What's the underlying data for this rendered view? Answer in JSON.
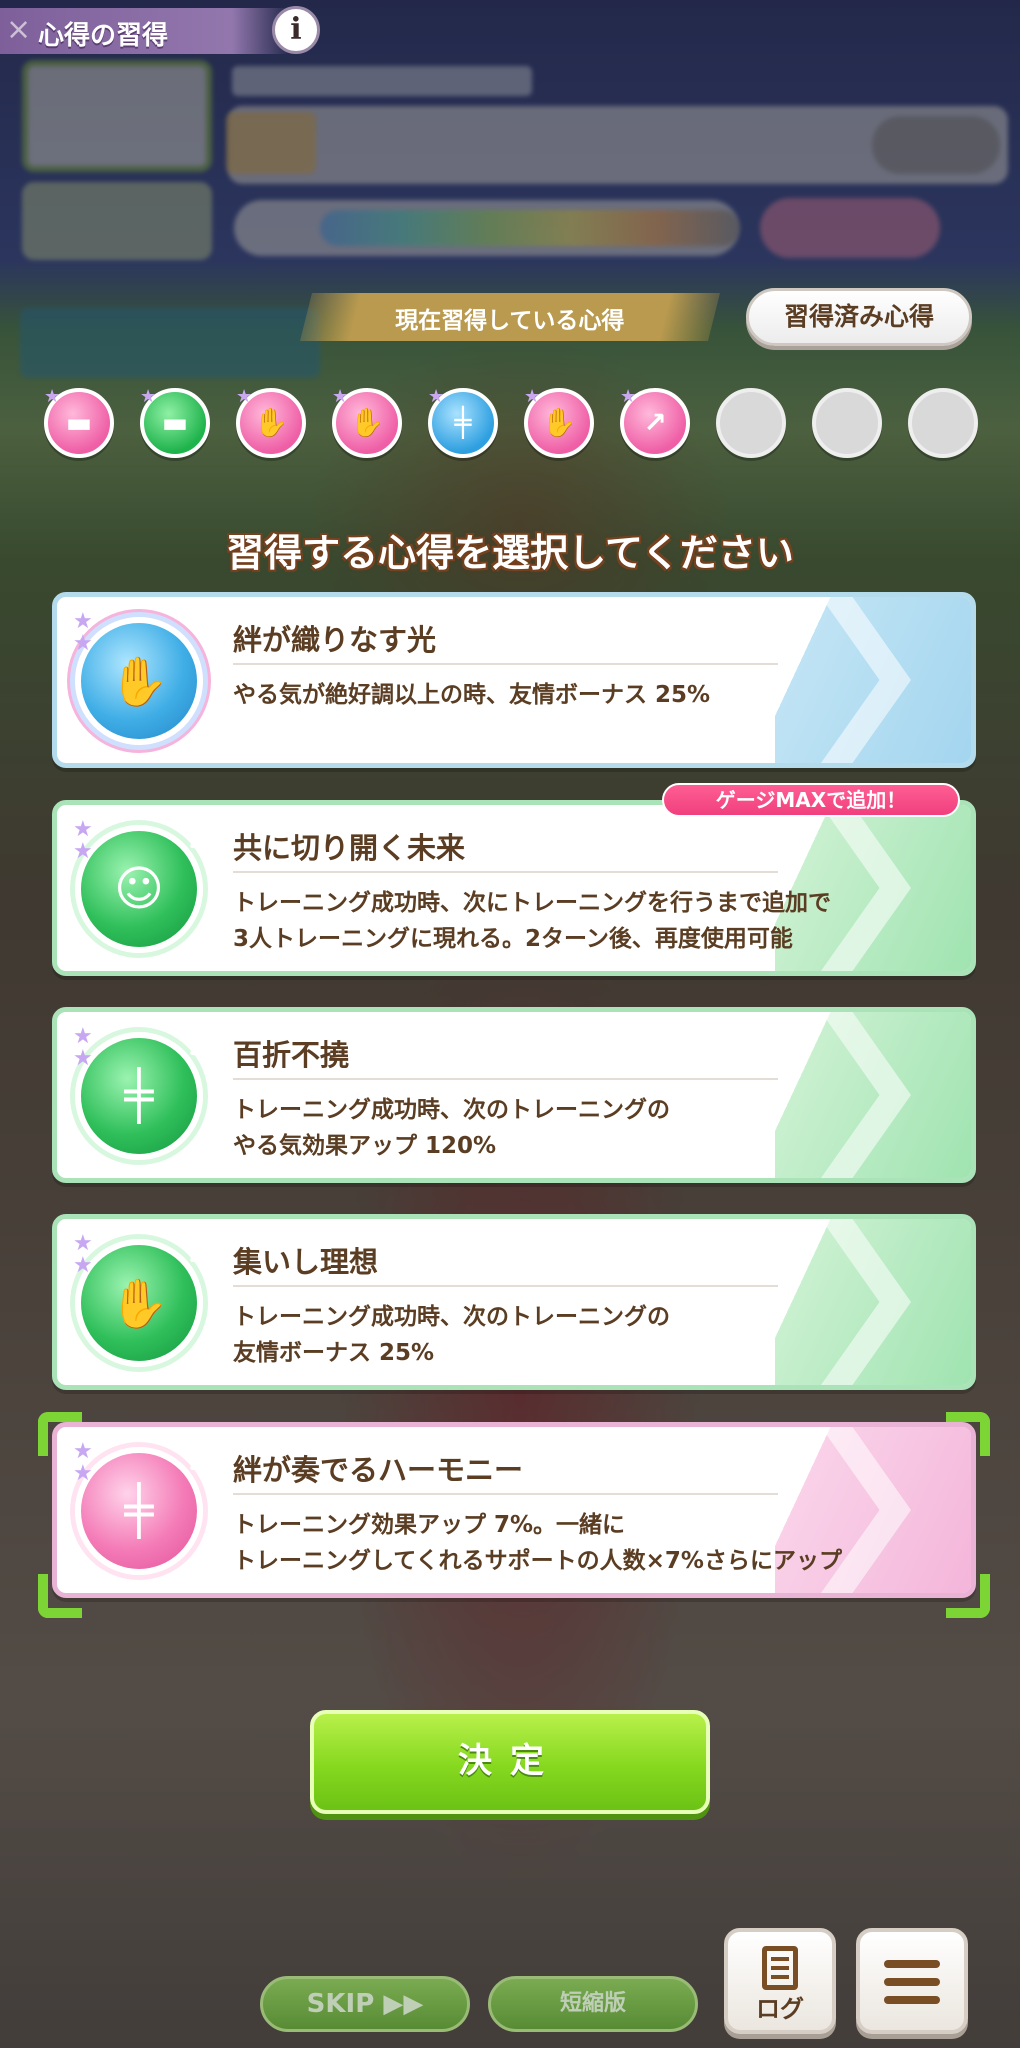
{
  "screen": {
    "title": "心得の習得",
    "info_label": "i"
  },
  "acquired": {
    "current_label": "現在習得している心得",
    "acquired_button": "習得済み心得",
    "slots": [
      {
        "color": "pink",
        "icon": "pill-icon"
      },
      {
        "color": "green",
        "icon": "pill-icon"
      },
      {
        "color": "pink",
        "icon": "handshake-icon"
      },
      {
        "color": "pink",
        "icon": "handshake-icon"
      },
      {
        "color": "blue",
        "icon": "dumbbell-icon"
      },
      {
        "color": "pink",
        "icon": "handshake-icon"
      },
      {
        "color": "pink",
        "icon": "dumbbell-up-icon"
      },
      {
        "color": "empty",
        "icon": ""
      },
      {
        "color": "empty",
        "icon": ""
      },
      {
        "color": "empty",
        "icon": ""
      }
    ]
  },
  "prompt": "習得する心得を選択してください",
  "badge": "ゲージMAXで追加！",
  "options": [
    {
      "name": "絆が織りなす光",
      "desc_line1": "やる気が絶好調以上の時、友情ボーナス 25%",
      "desc_line2": "",
      "color": "blue",
      "icon": "handshake-icon"
    },
    {
      "name": "共に切り開く未来",
      "desc_line1": "トレーニング成功時、次にトレーニングを行うまで追加で",
      "desc_line2": "3人トレーニングに現れる。2ターン後、再度使用可能",
      "color": "green",
      "icon": "support-rabbit-icon"
    },
    {
      "name": "百折不撓",
      "desc_line1": "トレーニング成功時、次のトレーニングの",
      "desc_line2": "やる気効果アップ 120%",
      "color": "green",
      "icon": "dumbbell-up-icon"
    },
    {
      "name": "集いし理想",
      "desc_line1": "トレーニング成功時、次のトレーニングの",
      "desc_line2": "友情ボーナス 25%",
      "color": "green",
      "icon": "handshake-icon"
    },
    {
      "name": "絆が奏でるハーモニー",
      "desc_line1": "トレーニング効果アップ 7%。一緒に",
      "desc_line2": "トレーニングしてくれるサポートの人数×7%さらにアップ",
      "color": "pink",
      "icon": "dumbbell-up-icon",
      "selected": true
    }
  ],
  "buttons": {
    "confirm": "決定",
    "skip": "SKIP ▶▶",
    "short": "短縮版",
    "log": "ログ"
  },
  "colors": {
    "accent_green": "#86d81f",
    "title_purple": "#8b6fa6",
    "badge_pink": "#f0407d",
    "text_brown": "#5a3d22"
  }
}
